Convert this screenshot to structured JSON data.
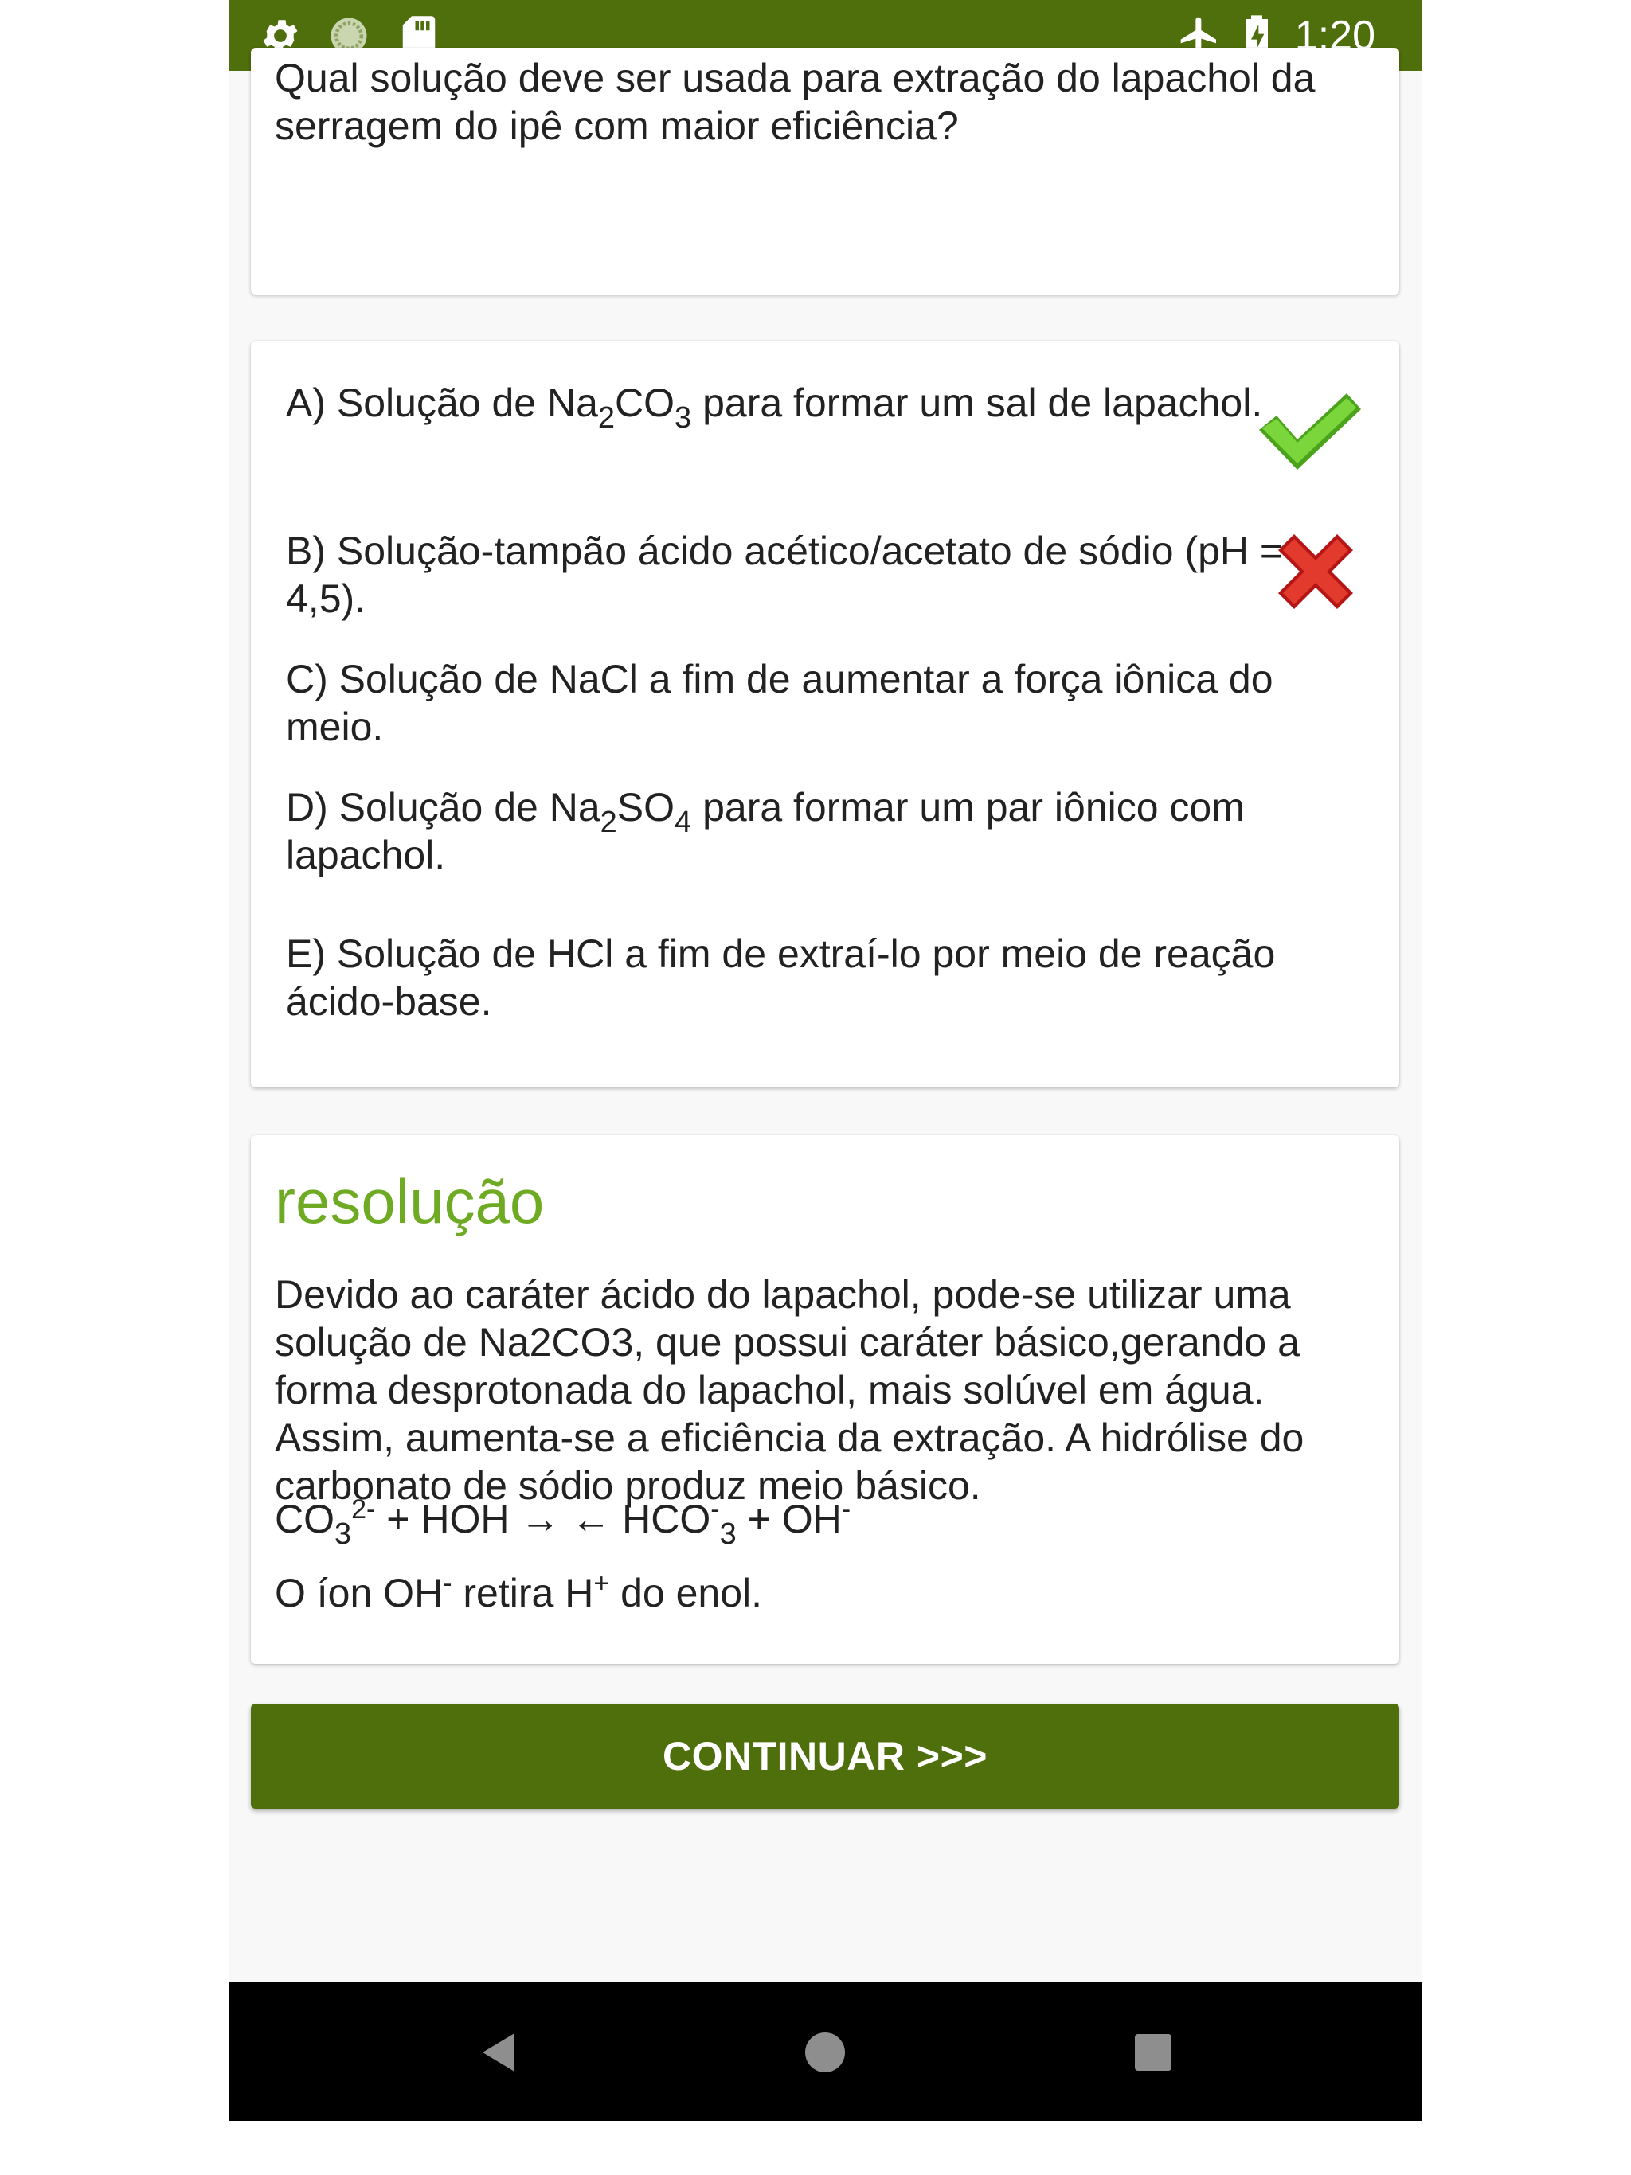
{
  "status_bar": {
    "time": "1:20",
    "left_icons": [
      "settings-gear-icon",
      "loading-circle-icon",
      "sd-card-icon"
    ],
    "right_icons": [
      "airplane-mode-icon",
      "battery-charging-icon"
    ]
  },
  "question": {
    "text": "Qual solução deve ser usada para extração do lapachol da serragem do ipê com maior eficiência?"
  },
  "options": {
    "a": {
      "prefix": "A) Solução de Na",
      "sub1": "2",
      "mid1": "CO",
      "sub2": "3",
      "suffix": " para formar um sal de lapachol.",
      "state": "correct"
    },
    "b": {
      "text": "B) Solução-tampão ácido acético/acetato de sódio (pH = 4,5).",
      "state": "wrong"
    },
    "c": {
      "text": "C) Solução de NaCl a fim de aumentar a força iônica do meio."
    },
    "d": {
      "prefix": "D) Solução de Na",
      "sub1": "2",
      "mid1": "SO",
      "sub2": "4",
      "suffix": " para formar um par iônico com lapachol."
    },
    "e": {
      "text": "E) Solução de HCl a fim de extraí-lo por meio de reação ácido-base."
    }
  },
  "resolution": {
    "title": "resolução",
    "text": "Devido ao caráter ácido do lapachol, pode-se utilizar uma solução de Na2CO3, que possui caráter básico,gerando a forma desprotonada do lapachol, mais solúvel em água. Assim, aumenta-se a eficiência da extração. A hidrólise do carbonato de sódio produz meio básico.",
    "formula": {
      "co": "CO",
      "co_sub": "3",
      "co_sup": "2-",
      "mid": " + HOH → ← HCO",
      "hco_sup": "-",
      "hco_sub": "3",
      "plus_oh": " + OH",
      "oh_sup": "-"
    },
    "note": {
      "p1": "O íon OH",
      "sup1": "-",
      "p2": " retira H",
      "sup2": "+",
      "p3": " do enol."
    }
  },
  "continue_button": {
    "label": "CONTINUAR >>>"
  },
  "nav_bar": {
    "icons": [
      "back-triangle-icon",
      "home-circle-icon",
      "recents-square-icon"
    ]
  },
  "colors": {
    "primary": "#4f6e0c",
    "accent_title": "#6eaa22",
    "correct": "#5cc51f",
    "wrong": "#d21d1d"
  }
}
